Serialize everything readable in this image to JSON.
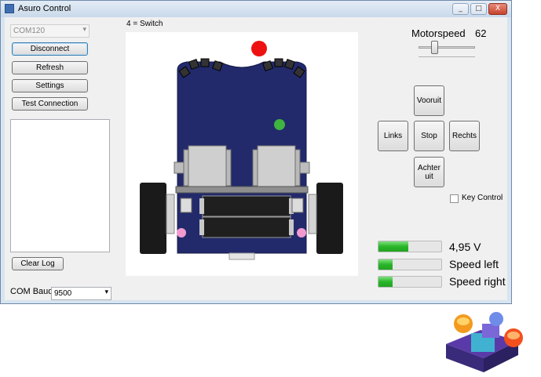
{
  "window": {
    "title": "Asuro Control",
    "controls": {
      "minimize": "_",
      "maximize": "□",
      "close": "X"
    }
  },
  "left": {
    "com_port": "COM120",
    "buttons": {
      "disconnect": "Disconnect",
      "refresh": "Refresh",
      "settings": "Settings",
      "test_connection": "Test Connection",
      "clear_log": "Clear Log"
    },
    "com_baud_label": "COM Baud",
    "com_baud_value": "9500"
  },
  "robot": {
    "switch_label": "4 = Switch"
  },
  "right": {
    "motorspeed_label": "Motorspeed",
    "motorspeed_value": "62",
    "motorspeed_level": 0.25,
    "buttons": {
      "forward": "Vooruit",
      "left": "Links",
      "stop": "Stop",
      "right": "Rechts",
      "backward": "Achter uit"
    },
    "key_control_label": "Key Control",
    "bars": [
      {
        "label": "4,95 V",
        "level": 0.48
      },
      {
        "label": "Speed left",
        "level": 0.23
      },
      {
        "label": "Speed right",
        "level": 0.23
      }
    ]
  },
  "colors": {
    "board": "#222a6b",
    "wheel": "#1a1a1a",
    "led_red": "#ee1111",
    "led_green": "#3fb43f",
    "led_pink": "#f29ad0",
    "progress": "#29b629"
  }
}
